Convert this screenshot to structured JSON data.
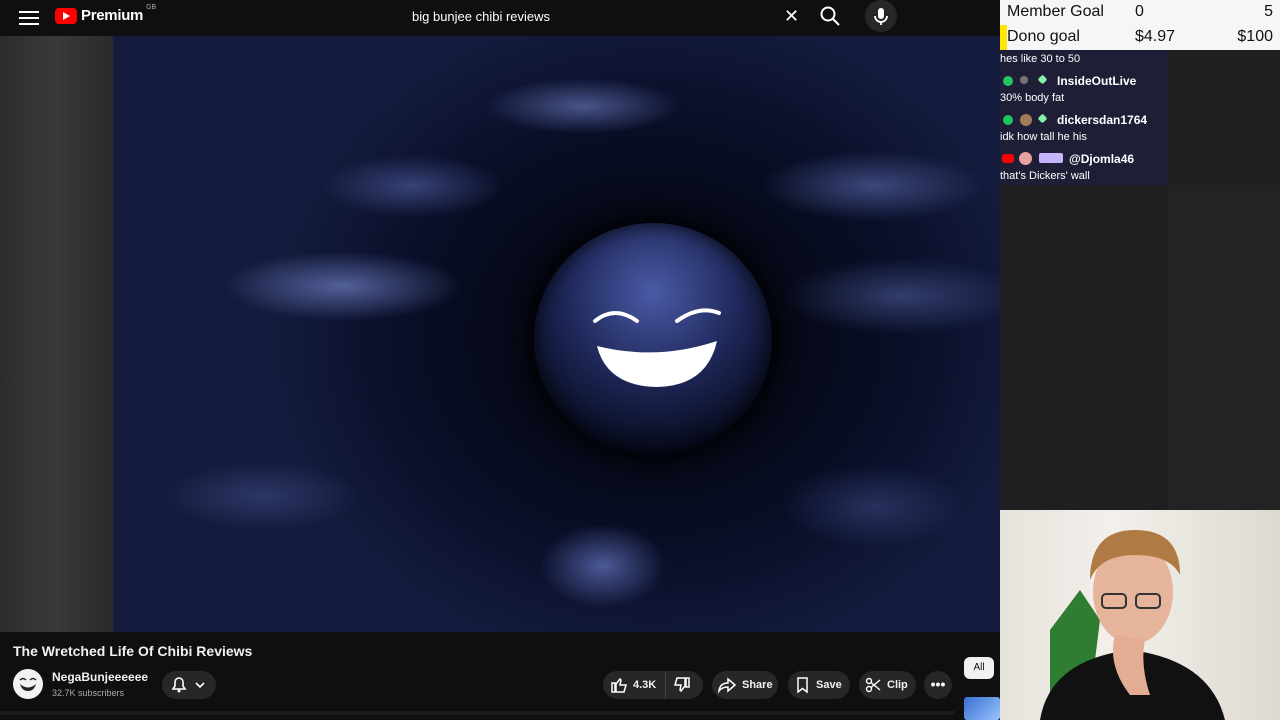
{
  "header": {
    "logo_text": "Premium",
    "region_code": "GB",
    "search_value": "big bunjee chibi reviews"
  },
  "video": {
    "title": "The Wretched Life Of Chibi Reviews",
    "channel_name": "NegaBunjeeeeee",
    "subscribers": "32.7K subscribers",
    "likes": "4.3K",
    "share_label": "Share",
    "save_label": "Save",
    "clip_label": "Clip",
    "more_label": "•••",
    "chip_all": "All"
  },
  "overlay": {
    "goals": [
      {
        "label": "Member Goal",
        "current": "0",
        "target": "5",
        "progress": 0.0
      },
      {
        "label": "Dono goal",
        "current": "$4.97",
        "target": "$100",
        "progress": 0.05
      }
    ],
    "chat": [
      {
        "user": "",
        "message": "hes like 30 to 50"
      },
      {
        "user": "InsideOutLive",
        "message": "30% body fat"
      },
      {
        "user": "dickersdan1764",
        "message": "idk how tall he his"
      },
      {
        "user": "@Djomla46",
        "message": "that's Dickers' wall"
      }
    ]
  },
  "colors": {
    "brand_red": "#ff0000",
    "goal_bar": "#ffe600",
    "chat_badge_green": "#22c55e"
  }
}
